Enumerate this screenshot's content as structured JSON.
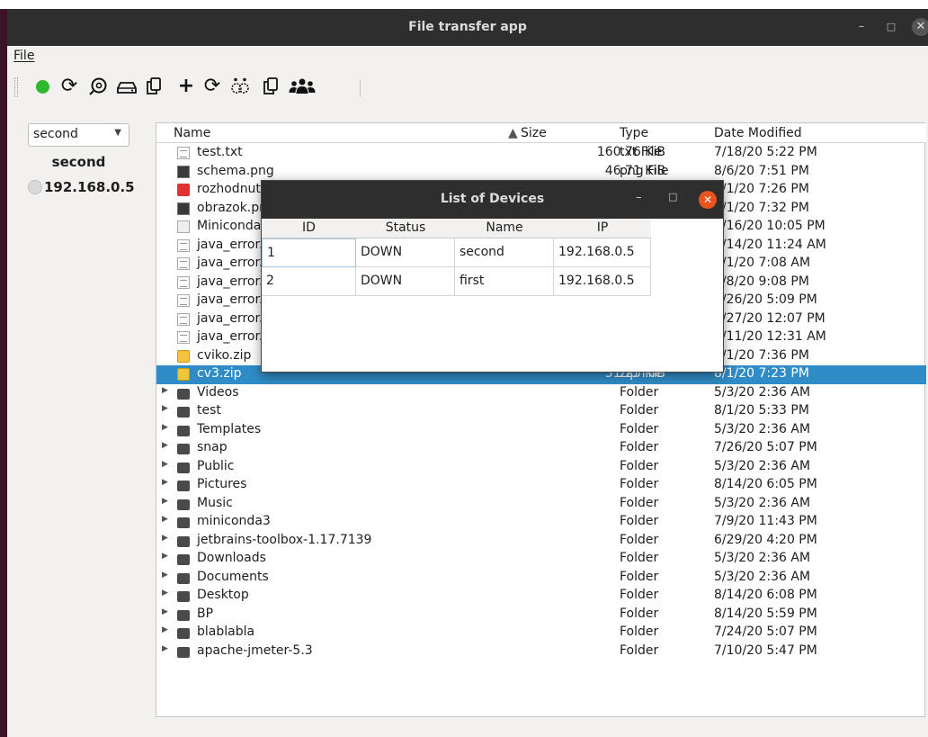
{
  "window": {
    "title": "File transfer app"
  },
  "menubar": {
    "file": "File"
  },
  "toolbar": {
    "icons": [
      "connect-icon",
      "refresh-icon",
      "scan-icon",
      "drive-icon",
      "copy-icon",
      "add-icon",
      "refresh-icon",
      "find-devices-icon",
      "copy-icon",
      "people-icon"
    ]
  },
  "devices_panel": {
    "combo_value": "second",
    "device_name": "second",
    "device_ip": "192.168.0.5"
  },
  "file_table": {
    "headers": {
      "name": "Name",
      "size": "Size",
      "type": "Type",
      "date": "Date Modified"
    },
    "rows": [
      {
        "icon": "text-file-icon",
        "name": "test.txt",
        "size": "160.76 KiB",
        "type": "txt File",
        "date": "7/18/20 5:22 PM"
      },
      {
        "icon": "image-file-icon",
        "name": "schema.png",
        "size": "46.71 KiB",
        "type": "png File",
        "date": "8/6/20 7:51 PM"
      },
      {
        "icon": "pdf-file-icon",
        "name": "rozhodnutie.pdf",
        "size": "",
        "type": "",
        "date": "8/1/20 7:26 PM"
      },
      {
        "icon": "image-file-icon",
        "name": "obrazok.png",
        "size": "",
        "type": "",
        "date": "8/1/20 7:32 PM"
      },
      {
        "icon": "script-file-icon",
        "name": "Miniconda3.sh",
        "size": "",
        "type": "",
        "date": "6/16/20 10:05 PM"
      },
      {
        "icon": "text-file-icon",
        "name": "java_error.log",
        "size": "",
        "type": "",
        "date": "7/14/20 11:24 AM"
      },
      {
        "icon": "text-file-icon",
        "name": "java_error.log",
        "size": "",
        "type": "",
        "date": "8/1/20 7:08 AM"
      },
      {
        "icon": "text-file-icon",
        "name": "java_error.log",
        "size": "",
        "type": "",
        "date": "8/8/20 9:08 PM"
      },
      {
        "icon": "text-file-icon",
        "name": "java_error.log",
        "size": "",
        "type": "",
        "date": "7/26/20 5:09 PM"
      },
      {
        "icon": "text-file-icon",
        "name": "java_error.log",
        "size": "",
        "type": "",
        "date": "7/27/20 12:07 PM"
      },
      {
        "icon": "text-file-icon",
        "name": "java_error.log",
        "size": "",
        "type": "",
        "date": "7/11/20 12:31 AM"
      },
      {
        "icon": "zip-file-icon",
        "name": "cviko.zip",
        "size": "",
        "type": "",
        "date": "8/1/20 7:36 PM"
      },
      {
        "icon": "zip-file-icon",
        "name": "cv3.zip",
        "size": "31.23 KiB",
        "type": "zip File",
        "date": "8/1/20 7:23 PM",
        "selected": true
      },
      {
        "icon": "folder-icon",
        "name": "Videos",
        "size": "",
        "type": "Folder",
        "date": "5/3/20 2:36 AM",
        "folder": true
      },
      {
        "icon": "folder-icon",
        "name": "test",
        "size": "",
        "type": "Folder",
        "date": "8/1/20 5:33 PM",
        "folder": true
      },
      {
        "icon": "folder-icon",
        "name": "Templates",
        "size": "",
        "type": "Folder",
        "date": "5/3/20 2:36 AM",
        "folder": true
      },
      {
        "icon": "folder-icon",
        "name": "snap",
        "size": "",
        "type": "Folder",
        "date": "7/26/20 5:07 PM",
        "folder": true
      },
      {
        "icon": "folder-icon",
        "name": "Public",
        "size": "",
        "type": "Folder",
        "date": "5/3/20 2:36 AM",
        "folder": true
      },
      {
        "icon": "folder-icon",
        "name": "Pictures",
        "size": "",
        "type": "Folder",
        "date": "8/14/20 6:05 PM",
        "folder": true
      },
      {
        "icon": "folder-icon",
        "name": "Music",
        "size": "",
        "type": "Folder",
        "date": "5/3/20 2:36 AM",
        "folder": true
      },
      {
        "icon": "folder-icon",
        "name": "miniconda3",
        "size": "",
        "type": "Folder",
        "date": "7/9/20 11:43 PM",
        "folder": true
      },
      {
        "icon": "folder-icon",
        "name": "jetbrains-toolbox-1.17.7139",
        "size": "",
        "type": "Folder",
        "date": "6/29/20 4:20 PM",
        "folder": true
      },
      {
        "icon": "folder-icon",
        "name": "Downloads",
        "size": "",
        "type": "Folder",
        "date": "5/3/20 2:36 AM",
        "folder": true
      },
      {
        "icon": "folder-icon",
        "name": "Documents",
        "size": "",
        "type": "Folder",
        "date": "5/3/20 2:36 AM",
        "folder": true
      },
      {
        "icon": "folder-icon",
        "name": "Desktop",
        "size": "",
        "type": "Folder",
        "date": "8/14/20 6:08 PM",
        "folder": true
      },
      {
        "icon": "folder-icon",
        "name": "BP",
        "size": "",
        "type": "Folder",
        "date": "8/14/20 5:59 PM",
        "folder": true
      },
      {
        "icon": "folder-icon",
        "name": "blablabla",
        "size": "",
        "type": "Folder",
        "date": "7/24/20 5:07 PM",
        "folder": true
      },
      {
        "icon": "folder-icon",
        "name": "apache-jmeter-5.3",
        "size": "",
        "type": "Folder",
        "date": "7/10/20 5:47 PM",
        "folder": true
      }
    ]
  },
  "dialog": {
    "title": "List of Devices",
    "headers": {
      "id": "ID",
      "status": "Status",
      "name": "Name",
      "ip": "IP"
    },
    "rows": [
      {
        "id": "1",
        "status": "DOWN",
        "name": "second",
        "ip": "192.168.0.5"
      },
      {
        "id": "2",
        "status": "DOWN",
        "name": "first",
        "ip": "192.168.0.5"
      }
    ]
  },
  "colors": {
    "selection": "#308cc6",
    "titlebar": "#2e2e2e",
    "close_button": "#e95420",
    "connect_indicator": "#2eb82e"
  }
}
